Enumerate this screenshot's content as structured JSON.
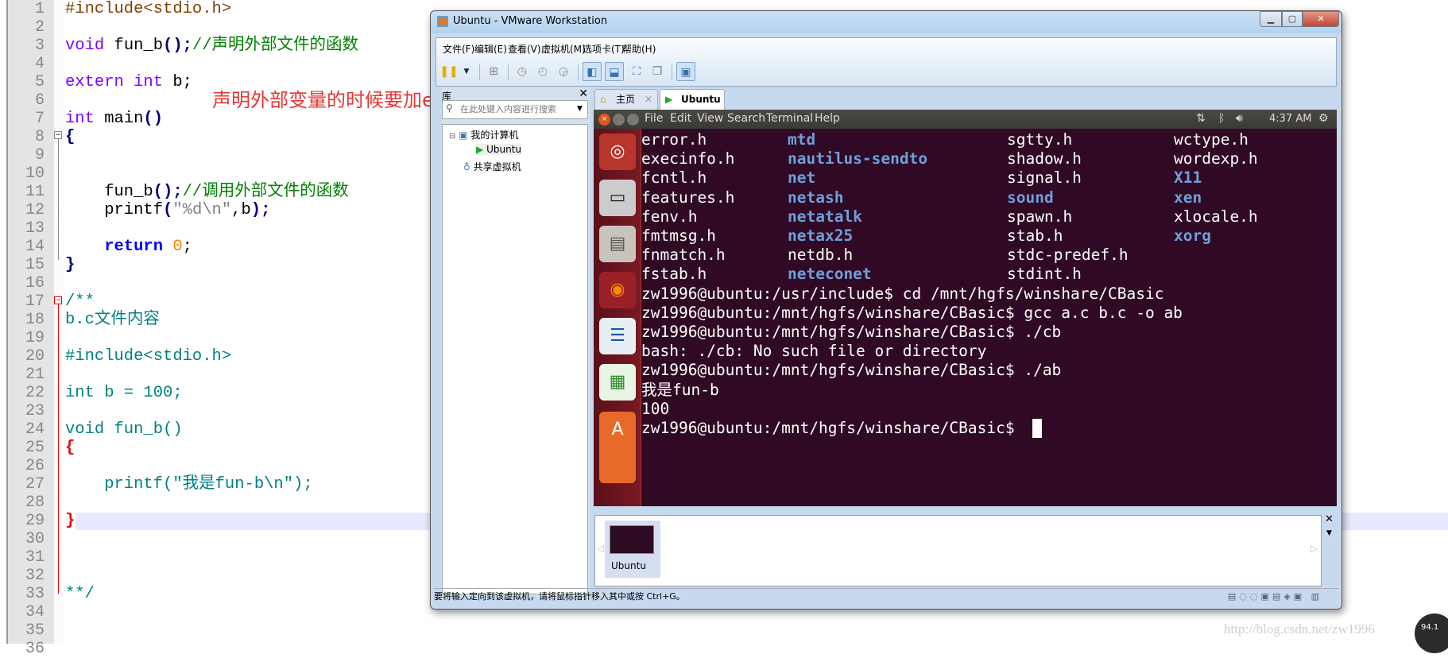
{
  "editor": {
    "line_numbers": [
      "1",
      "2",
      "3",
      "4",
      "5",
      "6",
      "7",
      "8",
      "9",
      "10",
      "11",
      "12",
      "13",
      "14",
      "15",
      "16",
      "17",
      "18",
      "19",
      "20",
      "21",
      "22",
      "23",
      "24",
      "25",
      "26",
      "27",
      "28",
      "29",
      "30",
      "31",
      "32",
      "33",
      "34",
      "35",
      "36"
    ],
    "lines": {
      "l1": "#include<stdio.h>",
      "l3a": "void",
      "l3b": " fun_b",
      "l3c": "();",
      "l3d": "//声明外部文件的函数",
      "l5a": "extern",
      "l5b": " int",
      "l5c": " b;",
      "l7a": "int",
      "l7b": " main",
      "l7c": "()",
      "l8": "{",
      "l11a": "    fun_b",
      "l11b": "();",
      "l11c": "//调用外部文件的函数",
      "l12a": "    printf",
      "l12b": "(",
      "l12c": "\"%d\\n\"",
      "l12d": ",b",
      ")": ")",
      "l12e": ");",
      "l14a": "    return",
      "l14b": " 0",
      "l14c": ";",
      "l15": "}",
      "l17": "/**",
      "l18": "b.c文件内容",
      "l20": "#include<stdio.h>",
      "l22": "int b = 100;",
      "l24": "void fun_b()",
      "l25": "{",
      "l27": "    printf(\"我是fun-b\\n\");",
      "l29": "}",
      "l33": "**/"
    },
    "annotation": "声明外部变量的时候要加extern"
  },
  "vmware": {
    "title": "Ubuntu - VMware Workstation",
    "window_buttons": [
      "minimize",
      "maximize",
      "close"
    ],
    "menu": [
      "文件(F)",
      "编辑(E)",
      "查看(V)",
      "虚拟机(M)",
      "选项卡(T)",
      "帮助(H)"
    ],
    "library": {
      "title": "库",
      "search_placeholder": "在此处键入内容进行搜索",
      "tree": [
        "我的计算机",
        "Ubuntu",
        "共享虚拟机"
      ]
    },
    "tabs": [
      "主页",
      "Ubuntu"
    ],
    "active_tab": "Ubuntu",
    "thumbnail_label": "Ubuntu",
    "status": "要将输入定向到该虚拟机，请将鼠标指针移入其中或按 Ctrl+G。"
  },
  "ubuntu": {
    "menu": [
      "File",
      "Edit",
      "View",
      "Search",
      "Terminal",
      "Help"
    ],
    "clock": "4:37 AM",
    "launcher": [
      "ubuntu-dash-icon",
      "terminal-icon",
      "files-icon",
      "firefox-icon",
      "writer-icon",
      "calc-icon",
      "software-center-icon"
    ],
    "colors": {
      "background": "#300a24",
      "directory": "#6f9fdb",
      "text": "#ffffff"
    }
  },
  "terminal": {
    "listing": [
      [
        "error.h",
        "mtd",
        "sgtty.h",
        "wctype.h"
      ],
      [
        "execinfo.h",
        "nautilus-sendto",
        "shadow.h",
        "wordexp.h"
      ],
      [
        "fcntl.h",
        "net",
        "signal.h",
        "X11"
      ],
      [
        "features.h",
        "netash",
        "sound",
        "xen"
      ],
      [
        "fenv.h",
        "netatalk",
        "spawn.h",
        "xlocale.h"
      ],
      [
        "fmtmsg.h",
        "netax25",
        "stab.h",
        "xorg"
      ],
      [
        "fnmatch.h",
        "netdb.h",
        "stdc-predef.h",
        ""
      ],
      [
        "fstab.h",
        "neteconet",
        "stdint.h",
        ""
      ]
    ],
    "lines": [
      "zw1996@ubuntu:/usr/include$ cd /mnt/hgfs/winshare/CBasic",
      "zw1996@ubuntu:/mnt/hgfs/winshare/CBasic$ gcc a.c b.c -o ab",
      "zw1996@ubuntu:/mnt/hgfs/winshare/CBasic$ ./cb",
      "bash: ./cb: No such file or directory",
      "zw1996@ubuntu:/mnt/hgfs/winshare/CBasic$ ./ab",
      "我是fun-b",
      "100",
      "zw1996@ubuntu:/mnt/hgfs/winshare/CBasic$ "
    ]
  },
  "watermark": "http://blog.csdn.net/zw1996",
  "badge": "94.1"
}
